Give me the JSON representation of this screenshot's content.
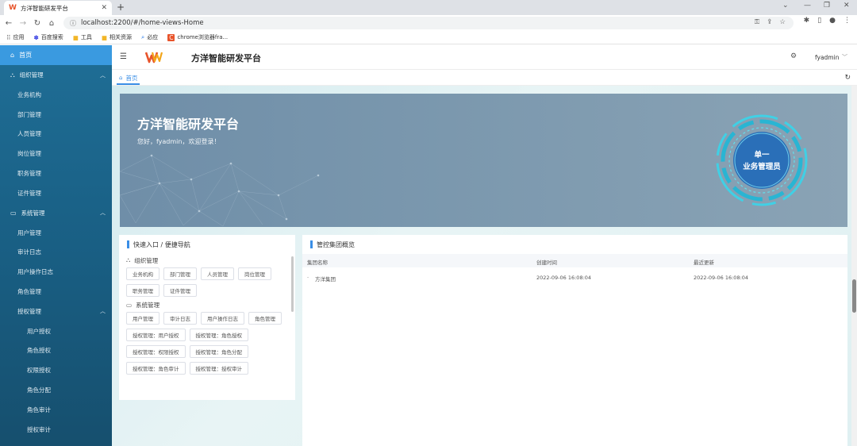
{
  "browser": {
    "tab_title": "方洋智能研发平台",
    "url": "localhost:2200/#/home-views-Home",
    "bookmarks": [
      {
        "label": "应用",
        "icon": "apps-grid-icon"
      },
      {
        "label": "百度搜索",
        "icon": "baidu-paw-icon"
      },
      {
        "label": "工具",
        "icon": "folder-icon"
      },
      {
        "label": "相关资源",
        "icon": "folder-icon"
      },
      {
        "label": "必应",
        "icon": "search-icon"
      },
      {
        "label": "chrome浏览器fra...",
        "icon": "chrome-c-icon"
      }
    ]
  },
  "sidebar": {
    "home": "首页",
    "groups": [
      {
        "label": "组织管理",
        "items": [
          "业务机构",
          "部门管理",
          "人员管理",
          "岗位管理",
          "职务管理",
          "证件管理"
        ]
      },
      {
        "label": "系统管理",
        "items": [
          "用户管理",
          "审计日志",
          "用户操作日志",
          "角色管理"
        ]
      }
    ],
    "auth_group": {
      "label": "授权管理",
      "items": [
        "用户授权",
        "角色授权",
        "权限授权",
        "角色分配",
        "角色审计",
        "授权审计"
      ]
    }
  },
  "header": {
    "title": "方洋智能研发平台",
    "user": "fyadmin",
    "tag_home": "首页"
  },
  "banner": {
    "title": "方洋智能研发平台",
    "welcome": "您好，fyadmin，欢迎登录！",
    "badge_line1": "单一",
    "badge_line2": "业务管理员"
  },
  "quick_nav": {
    "title": "快速入口 / 便捷导航",
    "groups": [
      {
        "label": "组织管理",
        "buttons": [
          "业务机构",
          "部门管理",
          "人员管理",
          "岗位管理",
          "职务管理",
          "证件管理"
        ]
      },
      {
        "label": "系统管理",
        "buttons": [
          "用户管理",
          "审计日志",
          "用户操作日志",
          "角色管理",
          "授权管理：用户授权",
          "授权管理：角色授权",
          "授权管理：权限授权",
          "授权管理：角色分配",
          "授权管理：角色审计",
          "授权管理：授权审计"
        ]
      }
    ]
  },
  "overview": {
    "title": "管控集团概览",
    "columns": [
      "集团名称",
      "创建时间",
      "最近更新"
    ],
    "rows": [
      [
        "方洋集团",
        "2022-09-06 16:08:04",
        "2022-09-06 16:08:04"
      ]
    ]
  }
}
